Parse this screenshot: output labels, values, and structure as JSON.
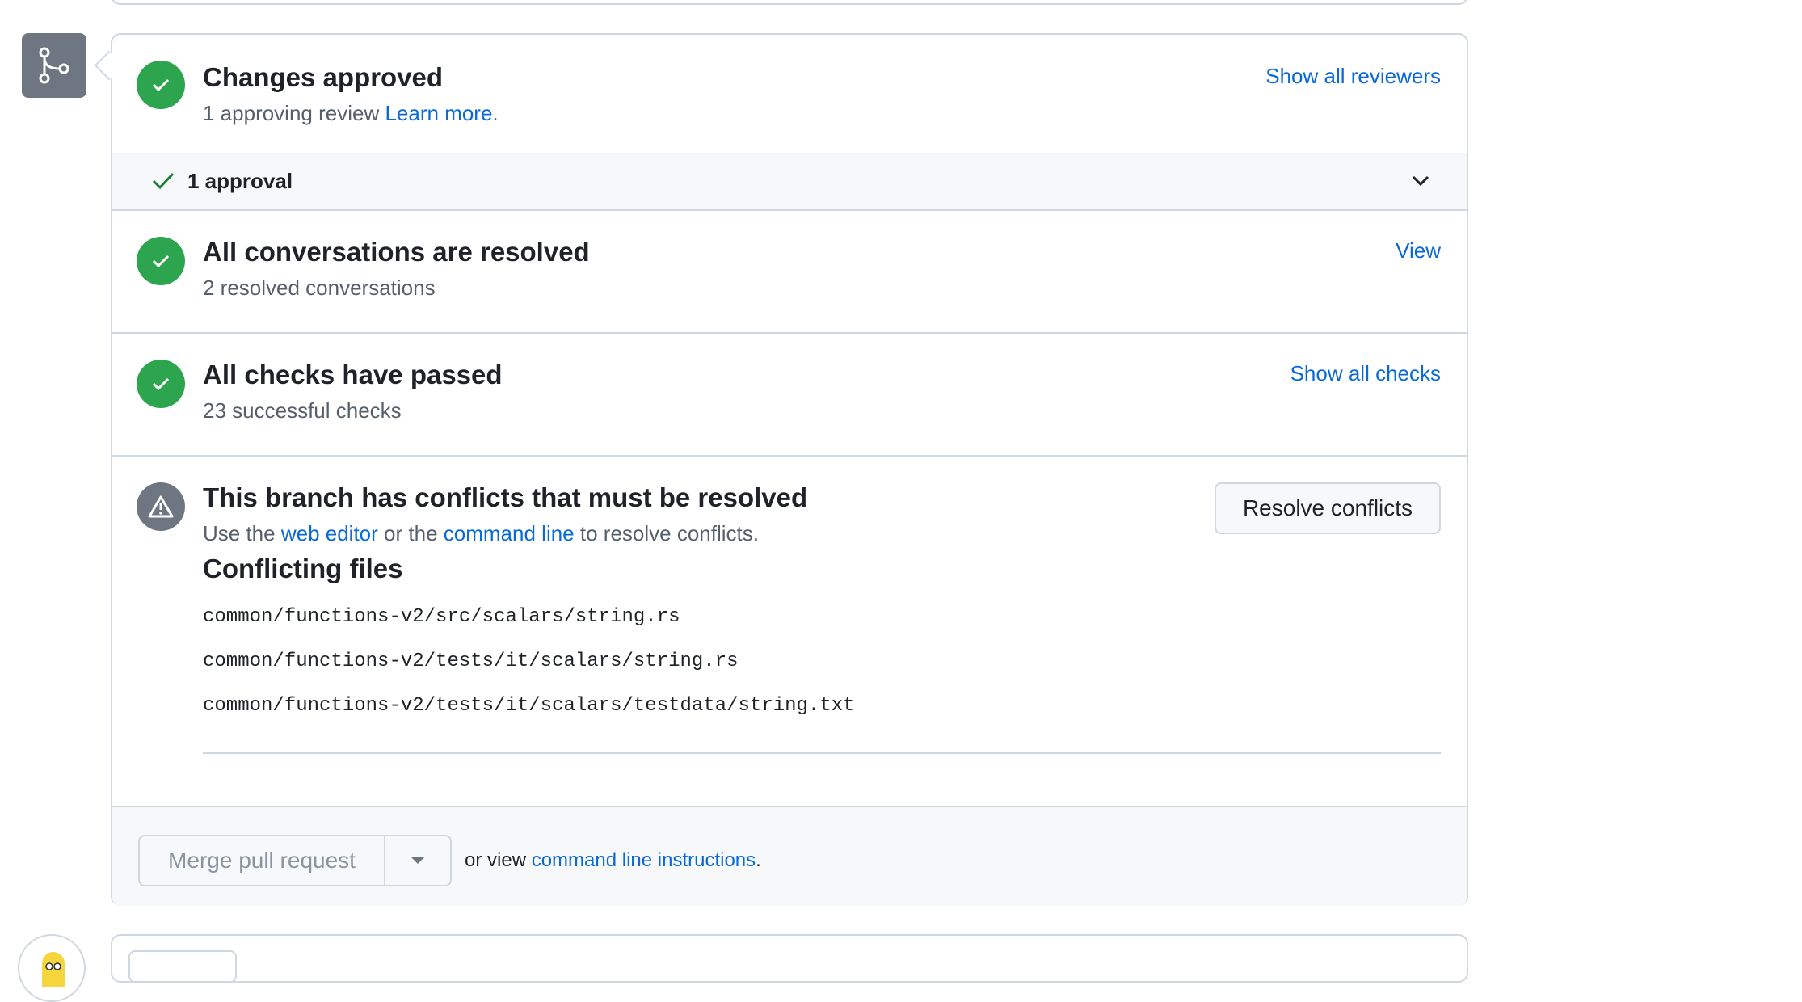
{
  "colors": {
    "success": "#2da44e",
    "neutral": "#6e7781",
    "link": "#0969da",
    "border": "#d0d7de",
    "muted_text": "#57606a"
  },
  "icons": {
    "merge_status": "git-merge-icon",
    "ok": "check-circle-icon",
    "warning": "alert-triangle-icon",
    "approval": "check-icon",
    "expand": "chevron-down-icon",
    "merge_dropdown": "triangle-down-icon",
    "avatar": "user-avatar"
  },
  "approved": {
    "title": "Changes approved",
    "subtitle": "1 approving review",
    "learn_more": "Learn more.",
    "action": "Show all reviewers",
    "approvals_label": "1 approval"
  },
  "conversations": {
    "title": "All conversations are resolved",
    "subtitle": "2 resolved conversations",
    "action": "View"
  },
  "checks": {
    "title": "All checks have passed",
    "subtitle": "23 successful checks",
    "action": "Show all checks"
  },
  "conflicts": {
    "title": "This branch has conflicts that must be resolved",
    "sub_prefix": "Use the",
    "web_editor": "web editor",
    "sub_middle": "or the",
    "command_line": "command line",
    "sub_suffix": "to resolve conflicts.",
    "button": "Resolve conflicts",
    "files_heading": "Conflicting files",
    "files": [
      "common/functions-v2/src/scalars/string.rs",
      "common/functions-v2/tests/it/scalars/string.rs",
      "common/functions-v2/tests/it/scalars/testdata/string.txt"
    ]
  },
  "merge": {
    "button": "Merge pull request",
    "or_view": "or view",
    "instructions_link": "command line instructions",
    "period": "."
  }
}
